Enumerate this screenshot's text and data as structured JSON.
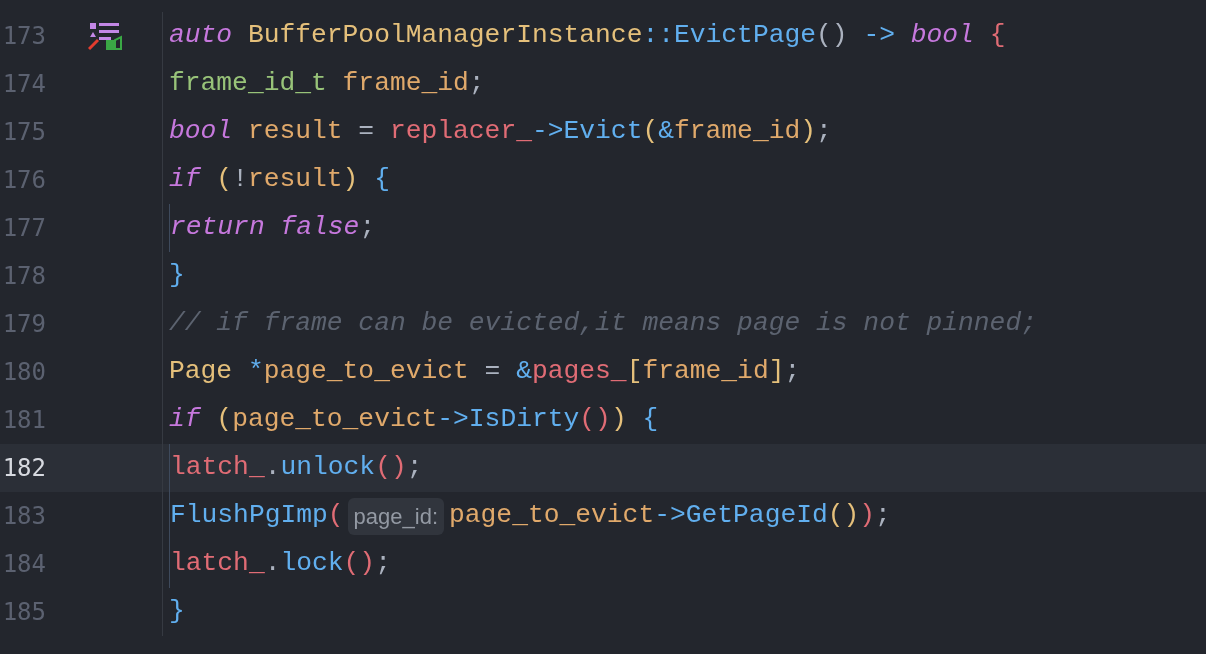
{
  "editor": {
    "lines": [
      {
        "number": "173",
        "current": false,
        "gutter_icon": true,
        "tokens": [
          {
            "kind": "keyword",
            "text": "auto "
          },
          {
            "kind": "type",
            "text": "BufferPoolManagerInstance"
          },
          {
            "kind": "operator",
            "text": "::"
          },
          {
            "kind": "function",
            "text": "EvictPage"
          },
          {
            "kind": "punctuation",
            "text": "() "
          },
          {
            "kind": "operator",
            "text": "-> "
          },
          {
            "kind": "keyword",
            "text": "bool "
          },
          {
            "kind": "bracket-red",
            "text": "{"
          }
        ],
        "children": [
          {
            "number": "174",
            "current": false,
            "gutter_icon": false,
            "tokens": [
              {
                "kind": "typedef",
                "text": "frame_id_t "
              },
              {
                "kind": "variable",
                "text": "frame_id"
              },
              {
                "kind": "punctuation",
                "text": ";"
              }
            ]
          },
          {
            "number": "175",
            "current": false,
            "gutter_icon": false,
            "tokens": [
              {
                "kind": "keyword",
                "text": "bool "
              },
              {
                "kind": "variable",
                "text": "result"
              },
              {
                "kind": "punctuation",
                "text": " = "
              },
              {
                "kind": "field",
                "text": "replacer_"
              },
              {
                "kind": "operator",
                "text": "->"
              },
              {
                "kind": "function",
                "text": "Evict"
              },
              {
                "kind": "bracket-yellow",
                "text": "("
              },
              {
                "kind": "operator",
                "text": "&"
              },
              {
                "kind": "variable",
                "text": "frame_id"
              },
              {
                "kind": "bracket-yellow",
                "text": ")"
              },
              {
                "kind": "punctuation",
                "text": ";"
              }
            ]
          },
          {
            "number": "176",
            "current": false,
            "gutter_icon": false,
            "tokens": [
              {
                "kind": "keyword",
                "text": "if "
              },
              {
                "kind": "bracket-yellow",
                "text": "("
              },
              {
                "kind": "punctuation",
                "text": "!"
              },
              {
                "kind": "variable",
                "text": "result"
              },
              {
                "kind": "bracket-yellow",
                "text": ") "
              },
              {
                "kind": "bracket-blue",
                "text": "{"
              }
            ],
            "children": [
              {
                "number": "177",
                "current": false,
                "gutter_icon": false,
                "tokens": [
                  {
                    "kind": "keyword",
                    "text": "return "
                  },
                  {
                    "kind": "keyword",
                    "text": "false"
                  },
                  {
                    "kind": "punctuation",
                    "text": ";"
                  }
                ]
              }
            ]
          },
          {
            "number": "178",
            "current": false,
            "gutter_icon": false,
            "tokens": [
              {
                "kind": "bracket-blue",
                "text": "}"
              }
            ]
          },
          {
            "number": "179",
            "current": false,
            "gutter_icon": false,
            "tokens": [
              {
                "kind": "comment",
                "text": "// if frame can be evicted,it means page is not pinned;"
              }
            ]
          },
          {
            "number": "180",
            "current": false,
            "gutter_icon": false,
            "tokens": [
              {
                "kind": "type",
                "text": "Page "
              },
              {
                "kind": "operator",
                "text": "*"
              },
              {
                "kind": "variable",
                "text": "page_to_evict"
              },
              {
                "kind": "punctuation",
                "text": " = "
              },
              {
                "kind": "operator",
                "text": "&"
              },
              {
                "kind": "field",
                "text": "pages_"
              },
              {
                "kind": "bracket-yellow",
                "text": "["
              },
              {
                "kind": "variable",
                "text": "frame_id"
              },
              {
                "kind": "bracket-yellow",
                "text": "]"
              },
              {
                "kind": "punctuation",
                "text": ";"
              }
            ]
          },
          {
            "number": "181",
            "current": false,
            "gutter_icon": false,
            "tokens": [
              {
                "kind": "keyword",
                "text": "if "
              },
              {
                "kind": "bracket-yellow",
                "text": "("
              },
              {
                "kind": "variable",
                "text": "page_to_evict"
              },
              {
                "kind": "operator",
                "text": "->"
              },
              {
                "kind": "function",
                "text": "IsDirty"
              },
              {
                "kind": "bracket-red",
                "text": "()"
              },
              {
                "kind": "bracket-yellow",
                "text": ") "
              },
              {
                "kind": "bracket-blue",
                "text": "{"
              }
            ],
            "children": [
              {
                "number": "182",
                "current": true,
                "gutter_icon": false,
                "tokens": [
                  {
                    "kind": "field",
                    "text": "latch_"
                  },
                  {
                    "kind": "punctuation",
                    "text": "."
                  },
                  {
                    "kind": "function",
                    "text": "unlock"
                  },
                  {
                    "kind": "bracket-red",
                    "text": "()"
                  },
                  {
                    "kind": "punctuation",
                    "text": ";"
                  }
                ]
              },
              {
                "number": "183",
                "current": false,
                "gutter_icon": false,
                "tokens": [
                  {
                    "kind": "function",
                    "text": "FlushPgImp"
                  },
                  {
                    "kind": "bracket-red",
                    "text": "("
                  },
                  {
                    "kind": "hint",
                    "text": "page_id:"
                  },
                  {
                    "kind": "variable",
                    "text": "page_to_evict"
                  },
                  {
                    "kind": "operator",
                    "text": "->"
                  },
                  {
                    "kind": "function",
                    "text": "GetPageId"
                  },
                  {
                    "kind": "bracket-yellow",
                    "text": "()"
                  },
                  {
                    "kind": "bracket-red",
                    "text": ")"
                  },
                  {
                    "kind": "punctuation",
                    "text": ";"
                  }
                ]
              },
              {
                "number": "184",
                "current": false,
                "gutter_icon": false,
                "tokens": [
                  {
                    "kind": "field",
                    "text": "latch_"
                  },
                  {
                    "kind": "punctuation",
                    "text": "."
                  },
                  {
                    "kind": "function",
                    "text": "lock"
                  },
                  {
                    "kind": "bracket-red",
                    "text": "()"
                  },
                  {
                    "kind": "punctuation",
                    "text": ";"
                  }
                ]
              }
            ]
          },
          {
            "number": "185",
            "current": false,
            "gutter_icon": false,
            "tokens": [
              {
                "kind": "bracket-blue",
                "text": "}"
              }
            ]
          }
        ]
      }
    ]
  }
}
